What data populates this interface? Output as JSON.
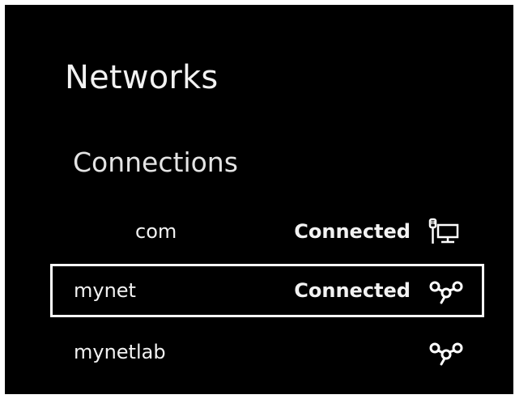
{
  "page": {
    "title": "Networks",
    "section_title": "Connections"
  },
  "connections": [
    {
      "name": "com",
      "status": "Connected",
      "icon": "ethernet-icon",
      "selected": false
    },
    {
      "name": "mynet",
      "status": "Connected",
      "icon": "vpn-link-icon",
      "selected": true
    },
    {
      "name": "mynetlab",
      "status": "",
      "icon": "vpn-link-icon",
      "selected": false
    }
  ],
  "colors": {
    "background": "#000000",
    "text": "#f2f2f2",
    "selection_border": "#ffffff"
  }
}
